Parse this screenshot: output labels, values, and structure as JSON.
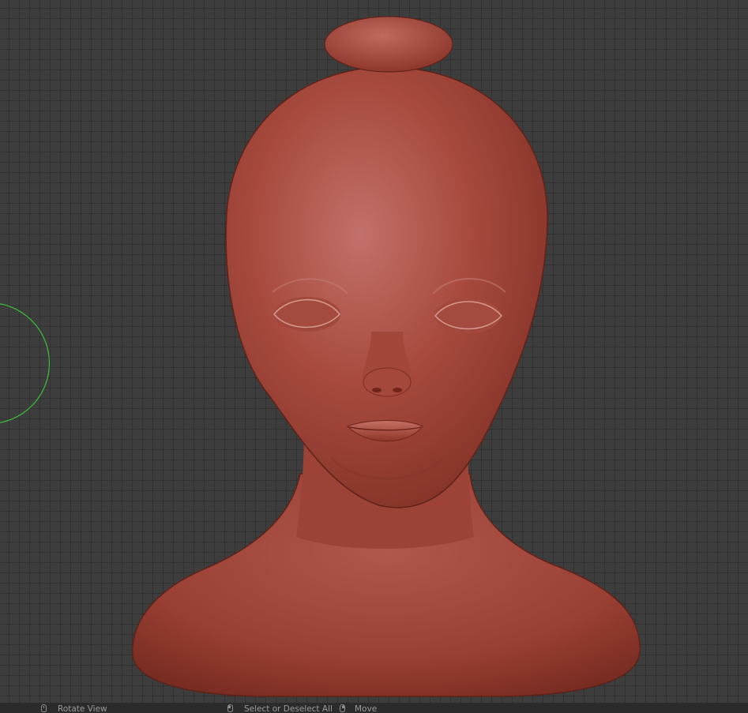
{
  "viewport": {
    "grid_color": "#3d3d3d",
    "model_color": "#a0453a",
    "brush_cursor_color": "#3ad63a"
  },
  "statusbar": {
    "hints": [
      {
        "icon": "middle-mouse-icon",
        "label": "Rotate View"
      },
      {
        "icon": "left-mouse-icon",
        "label": "Select or Deselect All"
      },
      {
        "icon": "right-mouse-icon",
        "label": "Move"
      }
    ]
  }
}
